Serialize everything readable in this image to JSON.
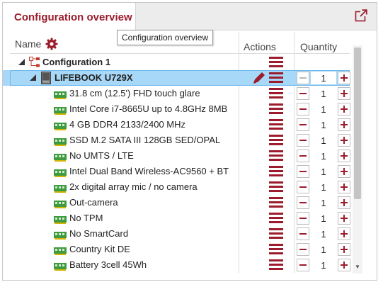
{
  "panel": {
    "tab_label": "Configuration overview",
    "tooltip": "Configuration overview",
    "external_link_icon": "external-link-icon"
  },
  "columns": {
    "name": "Name",
    "actions": "Actions",
    "quantity": "Quantity",
    "settings_icon": "gear-icon"
  },
  "tree": {
    "configuration_label": "Configuration 1",
    "product": {
      "label": "LIFEBOOK U729X",
      "quantity": "1"
    },
    "components": [
      {
        "label": "31.8 cm (12.5') FHD touch glare",
        "quantity": "1"
      },
      {
        "label": "Intel Core i7-8665U up to 4.8GHz 8MB",
        "quantity": "1"
      },
      {
        "label": "4 GB DDR4 2133/2400 MHz",
        "quantity": "1"
      },
      {
        "label": "SSD M.2 SATA III 128GB SED/OPAL",
        "quantity": "1"
      },
      {
        "label": "No UMTS / LTE",
        "quantity": "1"
      },
      {
        "label": "Intel Dual Band Wireless-AC9560 + BT",
        "quantity": "1"
      },
      {
        "label": "2x digital array mic / no camera",
        "quantity": "1"
      },
      {
        "label": "Out-camera",
        "quantity": "1"
      },
      {
        "label": "No TPM",
        "quantity": "1"
      },
      {
        "label": "No SmartCard",
        "quantity": "1"
      },
      {
        "label": "Country Kit DE",
        "quantity": "1"
      },
      {
        "label": "Battery 3cell 45Wh",
        "quantity": "1"
      }
    ]
  },
  "colors": {
    "accent": "#9b1c2c",
    "selection": "#a8d8f8"
  }
}
